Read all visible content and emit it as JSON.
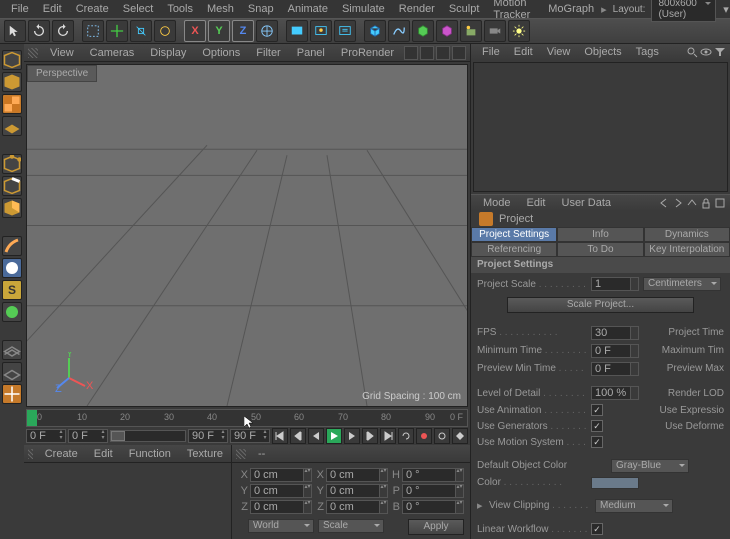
{
  "menubar": {
    "items": [
      "File",
      "Edit",
      "Create",
      "Select",
      "Tools",
      "Mesh",
      "Snap",
      "Animate",
      "Simulate",
      "Render",
      "Sculpt",
      "Motion Tracker",
      "MoGraph"
    ],
    "layout_label": "Layout:",
    "layout_value": "800x600 (User)"
  },
  "viewport_menu": [
    "View",
    "Cameras",
    "Display",
    "Options",
    "Filter",
    "Panel",
    "ProRender"
  ],
  "viewport": {
    "tab": "Perspective",
    "grid_info": "Grid Spacing : 100 cm"
  },
  "timeline": {
    "ticks": [
      "0",
      "10",
      "20",
      "30",
      "40",
      "50",
      "60",
      "70",
      "80",
      "90"
    ],
    "start_field": "0 F",
    "pos_field": "0 F",
    "end_field": "90 F",
    "len_field": "90 F",
    "cursor_frame": "0 F"
  },
  "bottom_left_menu": [
    "Create",
    "Edit",
    "Function",
    "Texture"
  ],
  "coords": {
    "rows": [
      {
        "axis": "X",
        "pos": "0 cm",
        "size": "0 cm",
        "rot_lbl": "H",
        "rot": "0 °"
      },
      {
        "axis": "Y",
        "pos": "0 cm",
        "size": "0 cm",
        "rot_lbl": "P",
        "rot": "0 °"
      },
      {
        "axis": "Z",
        "pos": "0 cm",
        "size": "0 cm",
        "rot_lbl": "B",
        "rot": "0 °"
      }
    ],
    "drop1": "World",
    "drop2": "Scale",
    "apply": "Apply"
  },
  "objmgr_menu": [
    "File",
    "Edit",
    "View",
    "Objects",
    "Tags"
  ],
  "attr_menu": [
    "Mode",
    "Edit",
    "User Data"
  ],
  "attr": {
    "title": "Project",
    "tabs": [
      "Project Settings",
      "Info",
      "Dynamics",
      "Referencing",
      "To Do",
      "Key Interpolation"
    ],
    "active_tab": 0,
    "section": "Project Settings",
    "project_scale_label": "Project Scale",
    "project_scale_value": "1",
    "project_scale_unit": "Centimeters",
    "scale_btn": "Scale Project...",
    "fps_label": "FPS",
    "fps_value": "30",
    "fps_right": "Project Time",
    "min_time_label": "Minimum Time",
    "min_time_value": "0 F",
    "min_time_right": "Maximum Tim",
    "prev_min_label": "Preview Min Time",
    "prev_min_value": "0 F",
    "prev_min_right": "Preview Max",
    "lod_label": "Level of Detail",
    "lod_value": "100 %",
    "lod_right": "Render LOD",
    "use_anim_label": "Use Animation",
    "use_anim_right": "Use Expressio",
    "use_gen_label": "Use Generators",
    "use_gen_right": "Use Deforme",
    "use_motion_label": "Use Motion System",
    "def_color_label": "Default Object Color",
    "def_color_value": "Gray-Blue",
    "color_label": "Color",
    "view_clip_label": "View Clipping",
    "view_clip_value": "Medium",
    "linear_label": "Linear Workflow"
  }
}
